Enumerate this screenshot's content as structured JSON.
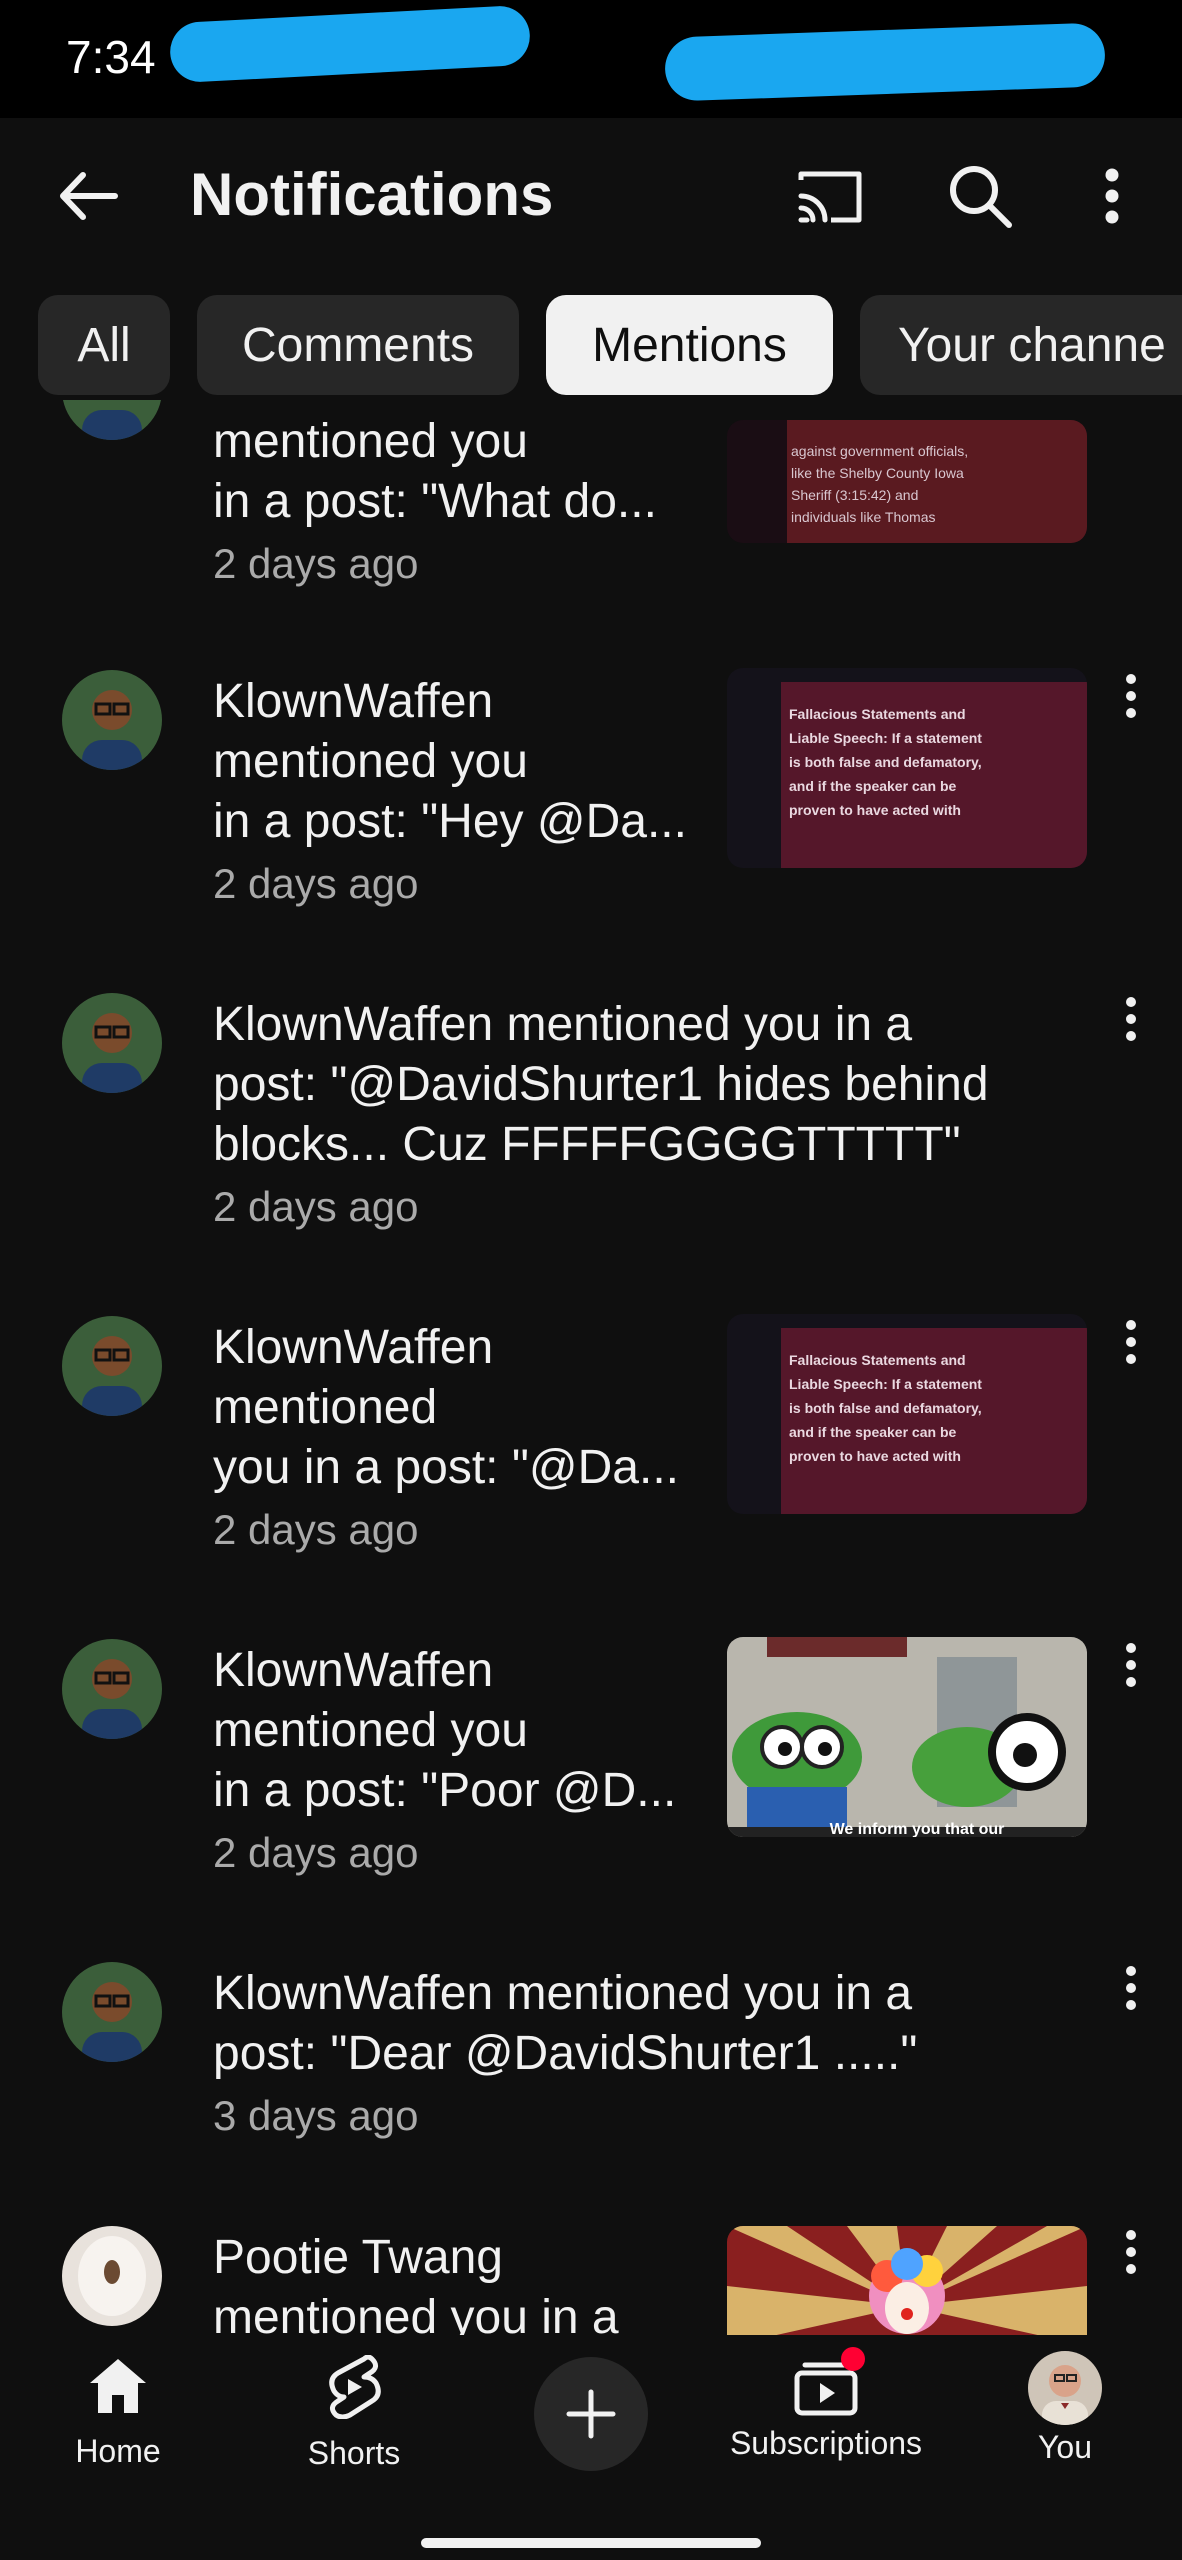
{
  "status_bar": {
    "time": "7:34"
  },
  "header": {
    "title": "Notifications",
    "icons": [
      "back-arrow-icon",
      "cast-icon",
      "search-icon",
      "more-vert-icon"
    ]
  },
  "chips": [
    {
      "label": "All",
      "active": false
    },
    {
      "label": "Comments",
      "active": false
    },
    {
      "label": "Mentions",
      "active": true
    },
    {
      "label": "Your channe",
      "active": false
    }
  ],
  "notifications": [
    {
      "lines": [
        "mentioned you",
        "in a post: \"What do..."
      ],
      "time": "2 days ago"
    },
    {
      "lines": [
        "KlownWaffen",
        "mentioned you",
        "in a post: \"Hey @Da..."
      ],
      "time": "2 days ago"
    },
    {
      "lines": [
        "KlownWaffen mentioned you in a",
        "post: \"@DavidShurter1 hides behind",
        "blocks... Cuz FFFFFGGGGTTTTT\""
      ],
      "time": "2 days ago"
    },
    {
      "lines": [
        "KlownWaffen",
        "mentioned",
        "you in a post: \"@Da..."
      ],
      "time": "2 days ago"
    },
    {
      "lines": [
        "KlownWaffen",
        "mentioned you",
        "in a post: \"Poor @D..."
      ],
      "time": "2 days ago"
    },
    {
      "lines": [
        "KlownWaffen mentioned you in a",
        "post: \"Dear @DavidShurter1 .....\""
      ],
      "time": "3 days ago"
    },
    {
      "lines": [
        "Pootie Twang",
        "mentioned you in a"
      ],
      "time": ""
    }
  ],
  "thumbnail_text": {
    "doc1": [
      "against government officials,",
      "like the Shelby County Iowa",
      "Sheriff (3:15:42) and",
      "individuals like Thomas"
    ],
    "doc2": [
      "Fallacious Statements and",
      "Liable Speech: If a statement",
      "is both false and defamatory,",
      "and if the speaker can be",
      "proven to have acted with"
    ],
    "meme": [
      "We inform you that our"
    ]
  },
  "bottom_nav": [
    {
      "label": "Home"
    },
    {
      "label": "Shorts"
    },
    {
      "label": "Subscriptions"
    },
    {
      "label": "You"
    }
  ],
  "colors": {
    "background": "#0f0f0f",
    "chip": "#272727",
    "secondary_text": "#aaaaaa",
    "badge": "#ff0033",
    "redaction": "#1aa7f0"
  }
}
